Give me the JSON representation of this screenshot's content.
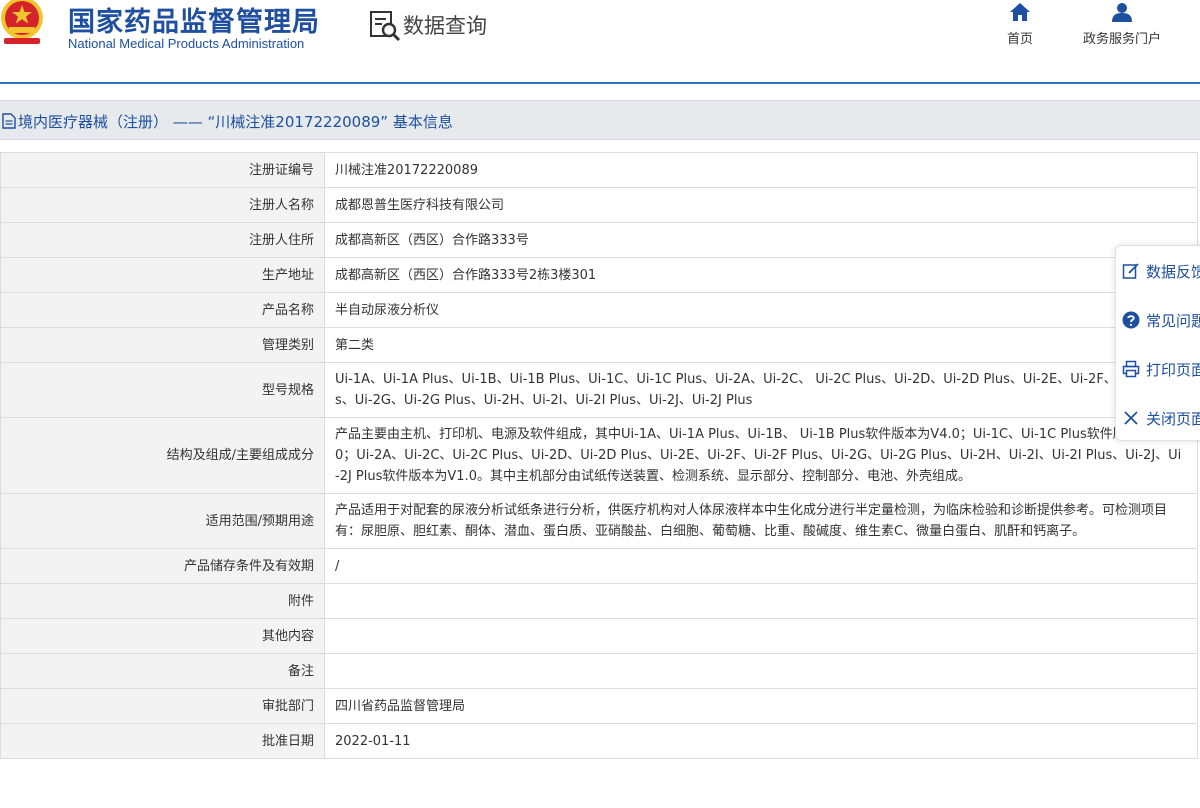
{
  "header": {
    "site_title": "国家药品监督管理局",
    "site_subtitle": "National Medical Products Administration",
    "query_title": "数据查询",
    "nav": [
      {
        "label": "首页",
        "icon": "home-icon"
      },
      {
        "label": "政务服务门户",
        "icon": "user-icon"
      }
    ]
  },
  "section": {
    "title": "境内医疗器械（注册） —— “川械注准20172220089” 基本信息"
  },
  "rows": [
    {
      "label": "注册证编号",
      "value": "川械注准20172220089"
    },
    {
      "label": "注册人名称",
      "value": "成都恩普生医疗科技有限公司"
    },
    {
      "label": "注册人住所",
      "value": "成都高新区（西区）合作路333号"
    },
    {
      "label": "生产地址",
      "value": "成都高新区（西区）合作路333号2栋3楼301"
    },
    {
      "label": "产品名称",
      "value": "半自动尿液分析仪"
    },
    {
      "label": "管理类别",
      "value": "第二类"
    },
    {
      "label": "型号规格",
      "value": "Ui-1A、Ui-1A Plus、Ui-1B、Ui-1B Plus、Ui-1C、Ui-1C Plus、Ui-2A、Ui-2C、 Ui-2C Plus、Ui-2D、Ui-2D Plus、Ui-2E、Ui-2F、Ui-2F Plus、Ui-2G、Ui-2G Plus、Ui-2H、Ui-2I、Ui-2I Plus、Ui-2J、Ui-2J Plus"
    },
    {
      "label": "结构及组成/主要组成成分",
      "value": "产品主要由主机、打印机、电源及软件组成，其中Ui-1A、Ui-1A Plus、Ui-1B、 Ui-1B Plus软件版本为V4.0；Ui-1C、Ui-1C Plus软件版本为V1.0；Ui-2A、Ui-2C、Ui-2C Plus、Ui-2D、Ui-2D Plus、Ui-2E、Ui-2F、Ui-2F Plus、Ui-2G、Ui-2G Plus、Ui-2H、Ui-2I、Ui-2I Plus、Ui-2J、Ui-2J Plus软件版本为V1.0。其中主机部分由试纸传送装置、检测系统、显示部分、控制部分、电池、外壳组成。"
    },
    {
      "label": "适用范围/预期用途",
      "value": "产品适用于对配套的尿液分析试纸条进行分析，供医疗机构对人体尿液样本中生化成分进行半定量检测，为临床检验和诊断提供参考。可检测项目有：尿胆原、胆红素、酮体、潜血、蛋白质、亚硝酸盐、白细胞、葡萄糖、比重、酸碱度、维生素C、微量白蛋白、肌酐和钙离子。"
    },
    {
      "label": "产品储存条件及有效期",
      "value": "/"
    },
    {
      "label": "附件",
      "value": ""
    },
    {
      "label": "其他内容",
      "value": ""
    },
    {
      "label": "备注",
      "value": ""
    },
    {
      "label": "审批部门",
      "value": "四川省药品监督管理局"
    },
    {
      "label": "批准日期",
      "value": "2022-01-11"
    }
  ],
  "float_panel": [
    {
      "label": "数据反馈",
      "icon": "edit-icon"
    },
    {
      "label": "常见问题",
      "icon": "question-icon"
    },
    {
      "label": "打印页面",
      "icon": "printer-icon"
    },
    {
      "label": "关闭页面",
      "icon": "close-icon"
    }
  ],
  "colors": {
    "brand_blue": "#1e4fa0",
    "header_line": "#2c6fbf",
    "label_bg": "#f3f3f3",
    "section_bg": "#e7eaed",
    "emblem_red": "#d5232a",
    "emblem_gold": "#f4c430"
  }
}
